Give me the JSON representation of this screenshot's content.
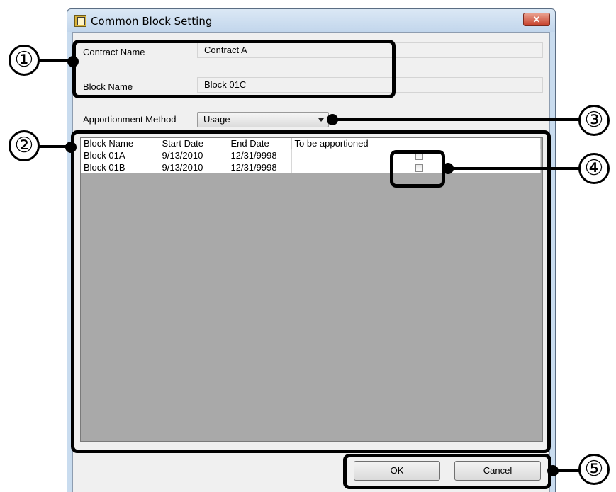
{
  "window": {
    "title": "Common Block Setting",
    "close_glyph": "✕"
  },
  "form": {
    "contract_name_label": "Contract Name",
    "contract_name_value": "Contract A",
    "block_name_label": "Block Name",
    "block_name_value": "Block 01C",
    "apportionment_label": "Apportionment Method",
    "apportionment_value": "Usage"
  },
  "grid": {
    "columns": [
      "Block Name",
      "Start Date",
      "End Date",
      "To be apportioned"
    ],
    "rows": [
      {
        "block_name": "Block 01A",
        "start_date": "9/13/2010",
        "end_date": "12/31/9998",
        "apportioned": false
      },
      {
        "block_name": "Block 01B",
        "start_date": "9/13/2010",
        "end_date": "12/31/9998",
        "apportioned": false
      }
    ]
  },
  "buttons": {
    "ok": "OK",
    "cancel": "Cancel"
  },
  "callouts": {
    "c1": "①",
    "c2": "②",
    "c3": "③",
    "c4": "④",
    "c5": "⑤"
  },
  "icons": {
    "app": "settings-window-icon",
    "close": "close-icon",
    "dropdown": "chevron-down-icon"
  }
}
